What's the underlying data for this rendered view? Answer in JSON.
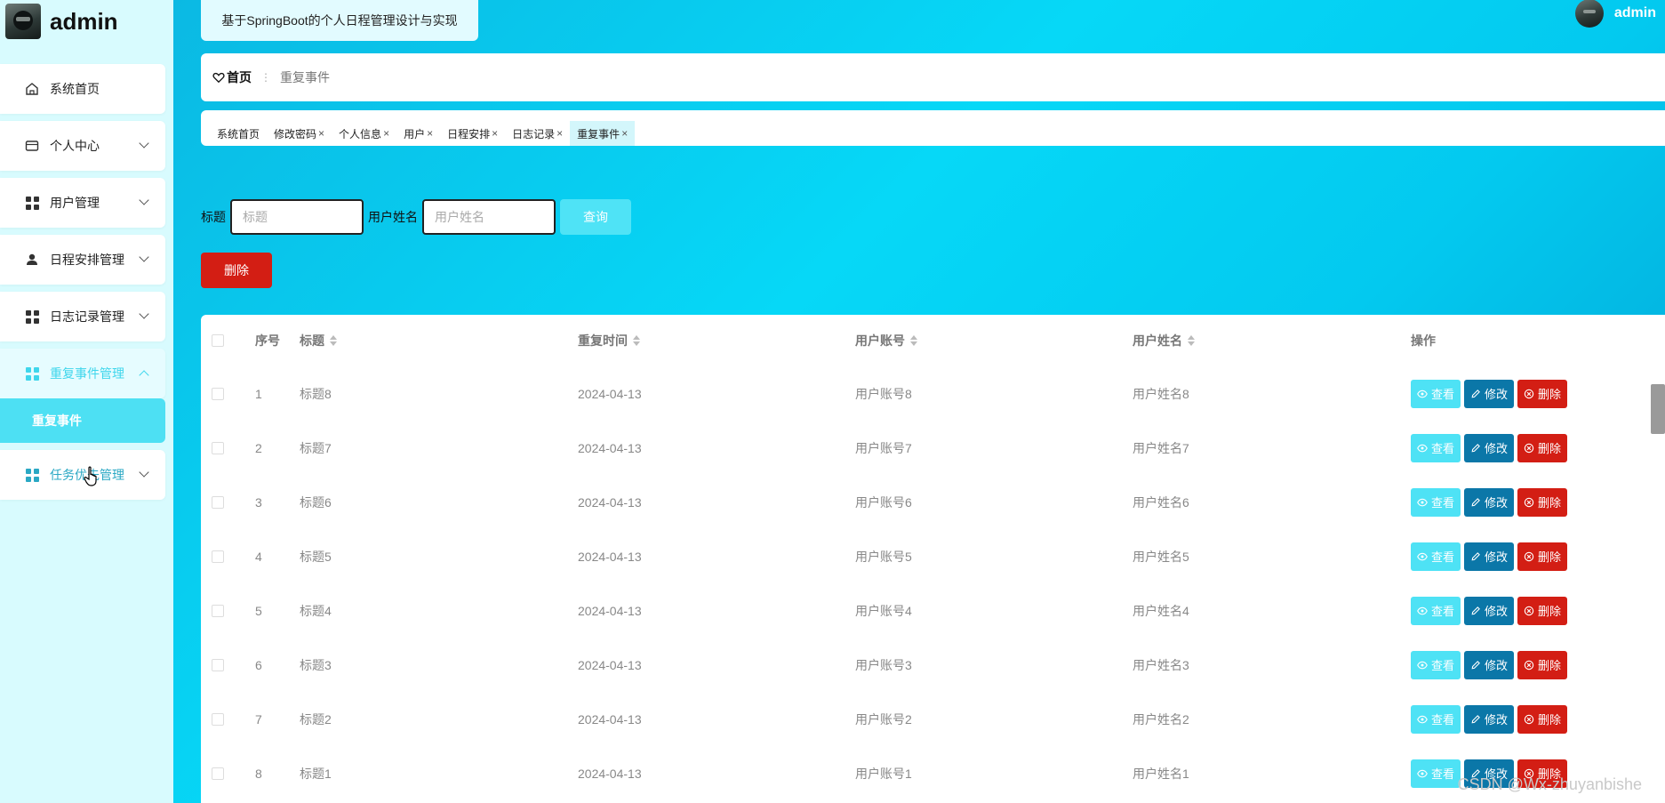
{
  "sidebar": {
    "username": "admin",
    "items": [
      {
        "label": "系统首页",
        "icon": "home-icon"
      },
      {
        "label": "个人中心",
        "icon": "wallet-icon"
      },
      {
        "label": "用户管理",
        "icon": "grid-icon"
      },
      {
        "label": "日程安排管理",
        "icon": "person-icon"
      },
      {
        "label": "日志记录管理",
        "icon": "grid-icon"
      },
      {
        "label": "重复事件管理",
        "icon": "grid-icon"
      },
      {
        "label": "任务优先管理",
        "icon": "grid-icon"
      }
    ],
    "sub_item": "重复事件"
  },
  "header": {
    "title": "基于SpringBoot的个人日程管理设计与实现",
    "user": "admin"
  },
  "breadcrumb": {
    "home": "首页",
    "separator": "⋮",
    "current": "重复事件"
  },
  "tabs": [
    {
      "label": "系统首页",
      "closable": false
    },
    {
      "label": "修改密码",
      "closable": true
    },
    {
      "label": "个人信息",
      "closable": true
    },
    {
      "label": "用户",
      "closable": true
    },
    {
      "label": "日程安排",
      "closable": true
    },
    {
      "label": "日志记录",
      "closable": true
    },
    {
      "label": "重复事件",
      "closable": true
    }
  ],
  "tab_close": "×",
  "search": {
    "title_label": "标题",
    "title_placeholder": "标题",
    "name_label": "用户姓名",
    "name_placeholder": "用户姓名",
    "query_button": "查询"
  },
  "delete_button": "删除",
  "table": {
    "headers": {
      "index": "序号",
      "title": "标题",
      "repeat_time": "重复时间",
      "account": "用户账号",
      "name": "用户姓名",
      "ops": "操作"
    },
    "rows": [
      {
        "index": "1",
        "title": "标题8",
        "repeat_time": "2024-04-13",
        "account": "用户账号8",
        "name": "用户姓名8"
      },
      {
        "index": "2",
        "title": "标题7",
        "repeat_time": "2024-04-13",
        "account": "用户账号7",
        "name": "用户姓名7"
      },
      {
        "index": "3",
        "title": "标题6",
        "repeat_time": "2024-04-13",
        "account": "用户账号6",
        "name": "用户姓名6"
      },
      {
        "index": "4",
        "title": "标题5",
        "repeat_time": "2024-04-13",
        "account": "用户账号5",
        "name": "用户姓名5"
      },
      {
        "index": "5",
        "title": "标题4",
        "repeat_time": "2024-04-13",
        "account": "用户账号4",
        "name": "用户姓名4"
      },
      {
        "index": "6",
        "title": "标题3",
        "repeat_time": "2024-04-13",
        "account": "用户账号3",
        "name": "用户姓名3"
      },
      {
        "index": "7",
        "title": "标题2",
        "repeat_time": "2024-04-13",
        "account": "用户账号2",
        "name": "用户姓名2"
      },
      {
        "index": "8",
        "title": "标题1",
        "repeat_time": "2024-04-13",
        "account": "用户账号1",
        "name": "用户姓名1"
      }
    ],
    "actions": {
      "view": "查看",
      "edit": "修改",
      "delete": "删除"
    }
  },
  "watermark": "CSDN @Wx-zhuyanbishe",
  "colors": {
    "accent": "#4ee2f5",
    "edit": "#0b77a8",
    "danger": "#d31e14"
  }
}
